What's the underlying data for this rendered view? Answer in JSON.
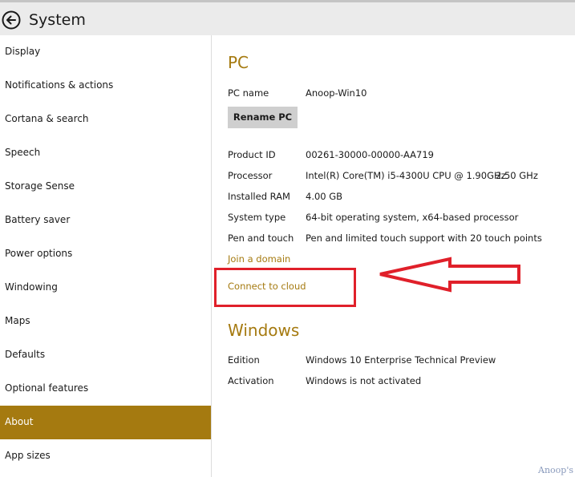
{
  "window": {
    "title": "System"
  },
  "sidebar": {
    "items": [
      {
        "label": "Display"
      },
      {
        "label": "Notifications & actions"
      },
      {
        "label": "Cortana & search"
      },
      {
        "label": "Speech"
      },
      {
        "label": "Storage Sense"
      },
      {
        "label": "Battery saver"
      },
      {
        "label": "Power options"
      },
      {
        "label": "Windowing"
      },
      {
        "label": "Maps"
      },
      {
        "label": "Defaults"
      },
      {
        "label": "Optional features"
      },
      {
        "label": "About"
      },
      {
        "label": "App sizes"
      }
    ],
    "active_item": "About"
  },
  "pc": {
    "heading": "PC",
    "pc_name_label": "PC name",
    "pc_name_value": "Anoop-Win10",
    "rename_button_label": "Rename PC",
    "product_id_label": "Product ID",
    "product_id_value": "00261-30000-00000-AA719",
    "processor_label": "Processor",
    "processor_value": "Intel(R) Core(TM) i5-4300U CPU @ 1.90GHz",
    "processor_speed": "2.50 GHz",
    "ram_label": "Installed RAM",
    "ram_value": "4.00 GB",
    "system_type_label": "System type",
    "system_type_value": "64-bit operating system, x64-based processor",
    "pen_label": "Pen and touch",
    "pen_value": "Pen and limited touch support with 20 touch points",
    "join_domain_link": "Join a domain",
    "connect_cloud_link": "Connect to cloud"
  },
  "windows": {
    "heading": "Windows",
    "edition_label": "Edition",
    "edition_value": "Windows 10 Enterprise Technical Preview",
    "activation_label": "Activation",
    "activation_value": "Windows is not activated"
  },
  "watermark": {
    "text": "Anoop's"
  },
  "colors": {
    "accent": "#a57a10",
    "annotation": "#e0202a",
    "titlebar": "#ebebeb",
    "button": "#cfcfcf"
  }
}
